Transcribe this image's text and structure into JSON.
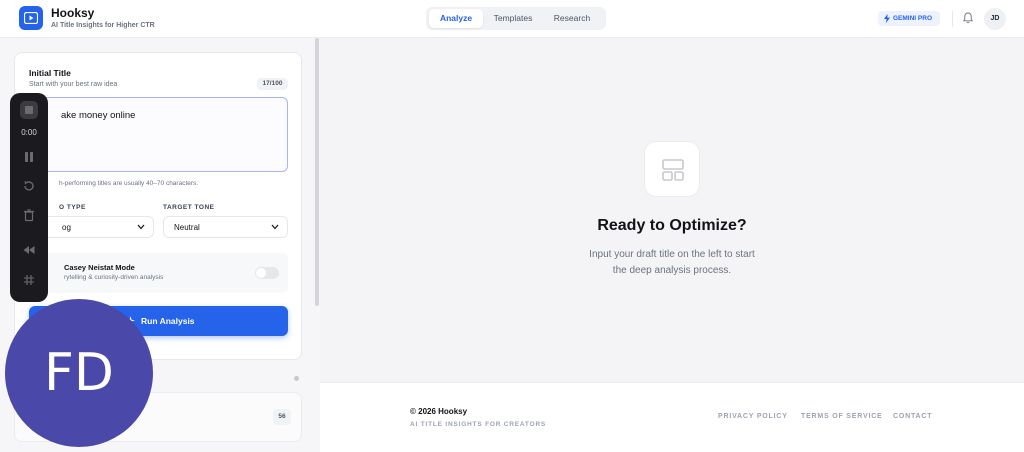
{
  "header": {
    "brand": "Hooksy",
    "tagline": "AI Title Insights for Higher CTR",
    "tabs": [
      "Analyze",
      "Templates",
      "Research"
    ],
    "active_tab": "Analyze",
    "badge": "GEMINI PRO",
    "user_initials": "JD",
    "accent": "#2563eb"
  },
  "form": {
    "initial_title_label": "Initial Title",
    "initial_title_sub": "Start with your best raw idea",
    "char_count": "17/100",
    "title_value": "ake money online",
    "hint": "h-performing titles are usually 40–70 characters.",
    "video_type_label": "O TYPE",
    "video_type_value": "og",
    "target_tone_label": "TARGET TONE",
    "target_tone_value": "Neutral",
    "mode_title": "Casey Neistat Mode",
    "mode_sub": "rytelling & curiosity-driven analysis",
    "mode_enabled": false,
    "run_button": "Run Analysis"
  },
  "history": {
    "score": "56"
  },
  "recorder": {
    "time": "0:00",
    "icons": [
      "stop-icon",
      "pause-icon",
      "restart-icon",
      "trash-icon",
      "rewind-icon",
      "grid-icon"
    ]
  },
  "main": {
    "title": "Ready to Optimize?",
    "desc_line1": "Input your draft title on the left to start",
    "desc_line2": "the deep analysis process."
  },
  "footer": {
    "copyright": "© 2026 Hooksy",
    "tagline": "AI TITLE INSIGHTS FOR CREATORS",
    "links": [
      "PRIVACY POLICY",
      "TERMS OF SERVICE",
      "CONTACT"
    ]
  },
  "webcam": {
    "initials": "FD",
    "color": "#4a48a8"
  }
}
